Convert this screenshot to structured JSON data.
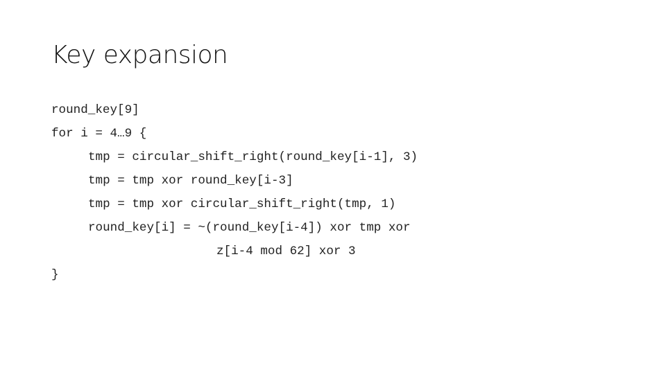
{
  "slide": {
    "title": "Key expansion",
    "code_lines": [
      "round_key[9]",
      "for i = 4…9 {",
      "tmp = circular_shift_right(round_key[i-1], 3)",
      "tmp = tmp xor round_key[i-3]",
      "tmp = tmp xor circular_shift_right(tmp, 1)",
      "round_key[i] = ~(round_key[i-4]) xor tmp xor",
      "z[i-4 mod 62] xor 3",
      "}"
    ]
  }
}
